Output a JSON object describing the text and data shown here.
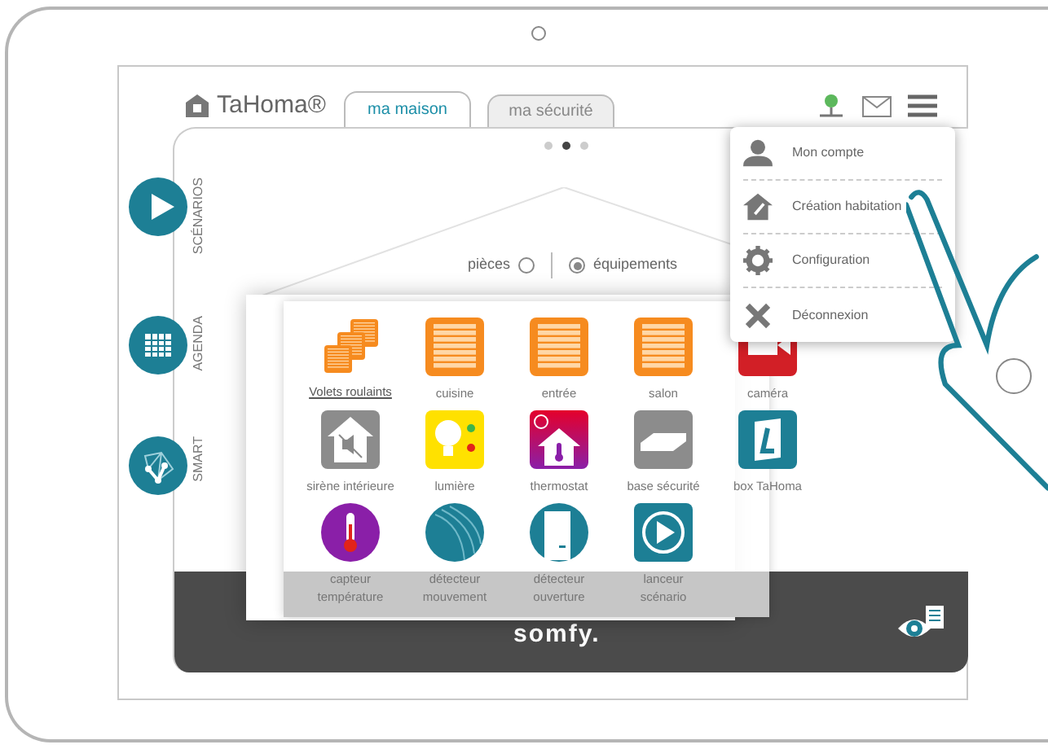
{
  "logo": {
    "text": "TaHoma®"
  },
  "tabs": [
    {
      "label": "ma maison",
      "selected": true
    },
    {
      "label": "ma sécurité",
      "selected": false
    }
  ],
  "pager": [
    {
      "selected": false
    },
    {
      "selected": true
    },
    {
      "selected": false
    }
  ],
  "side_nav": [
    {
      "label": "SCÉNARIOS",
      "kind": "play"
    },
    {
      "label": "AGENDA",
      "kind": "calendar"
    },
    {
      "label": "SMART",
      "kind": "network"
    }
  ],
  "view_toggle": [
    {
      "label": "pièces",
      "selected": false
    },
    {
      "label": "équipements",
      "selected": true
    }
  ],
  "devices": [
    {
      "label": "Volets roulaints",
      "kind": "shutters",
      "link": true
    },
    {
      "label": "cuisine",
      "kind": "shutter",
      "link": false
    },
    {
      "label": "entrée",
      "kind": "shutter",
      "link": false
    },
    {
      "label": "salon",
      "kind": "shutter",
      "link": false
    },
    {
      "label": "caméra",
      "kind": "camera",
      "link": false
    },
    {
      "label": "sirène intérieure",
      "kind": "siren",
      "link": false
    },
    {
      "label": "lumière",
      "kind": "light",
      "link": false
    },
    {
      "label": "thermostat",
      "kind": "thermostat",
      "link": false
    },
    {
      "label": "base sécurité",
      "kind": "base",
      "link": false
    },
    {
      "label": "box TaHoma",
      "kind": "box",
      "link": false
    },
    {
      "label": "capteur température",
      "kind": "temp",
      "link": false
    },
    {
      "label": "détecteur mouvement",
      "kind": "motion",
      "link": false
    },
    {
      "label": "détecteur ouverture",
      "kind": "door",
      "link": false
    },
    {
      "label": "lanceur scénario",
      "kind": "launcher",
      "link": false
    }
  ],
  "menu": [
    {
      "label": "Mon compte",
      "kind": "account"
    },
    {
      "label": "Création habitation",
      "kind": "house"
    },
    {
      "label": "Configuration",
      "kind": "gear"
    },
    {
      "label": "Déconnexion",
      "kind": "close"
    }
  ],
  "footer": {
    "brand": "somfy."
  }
}
